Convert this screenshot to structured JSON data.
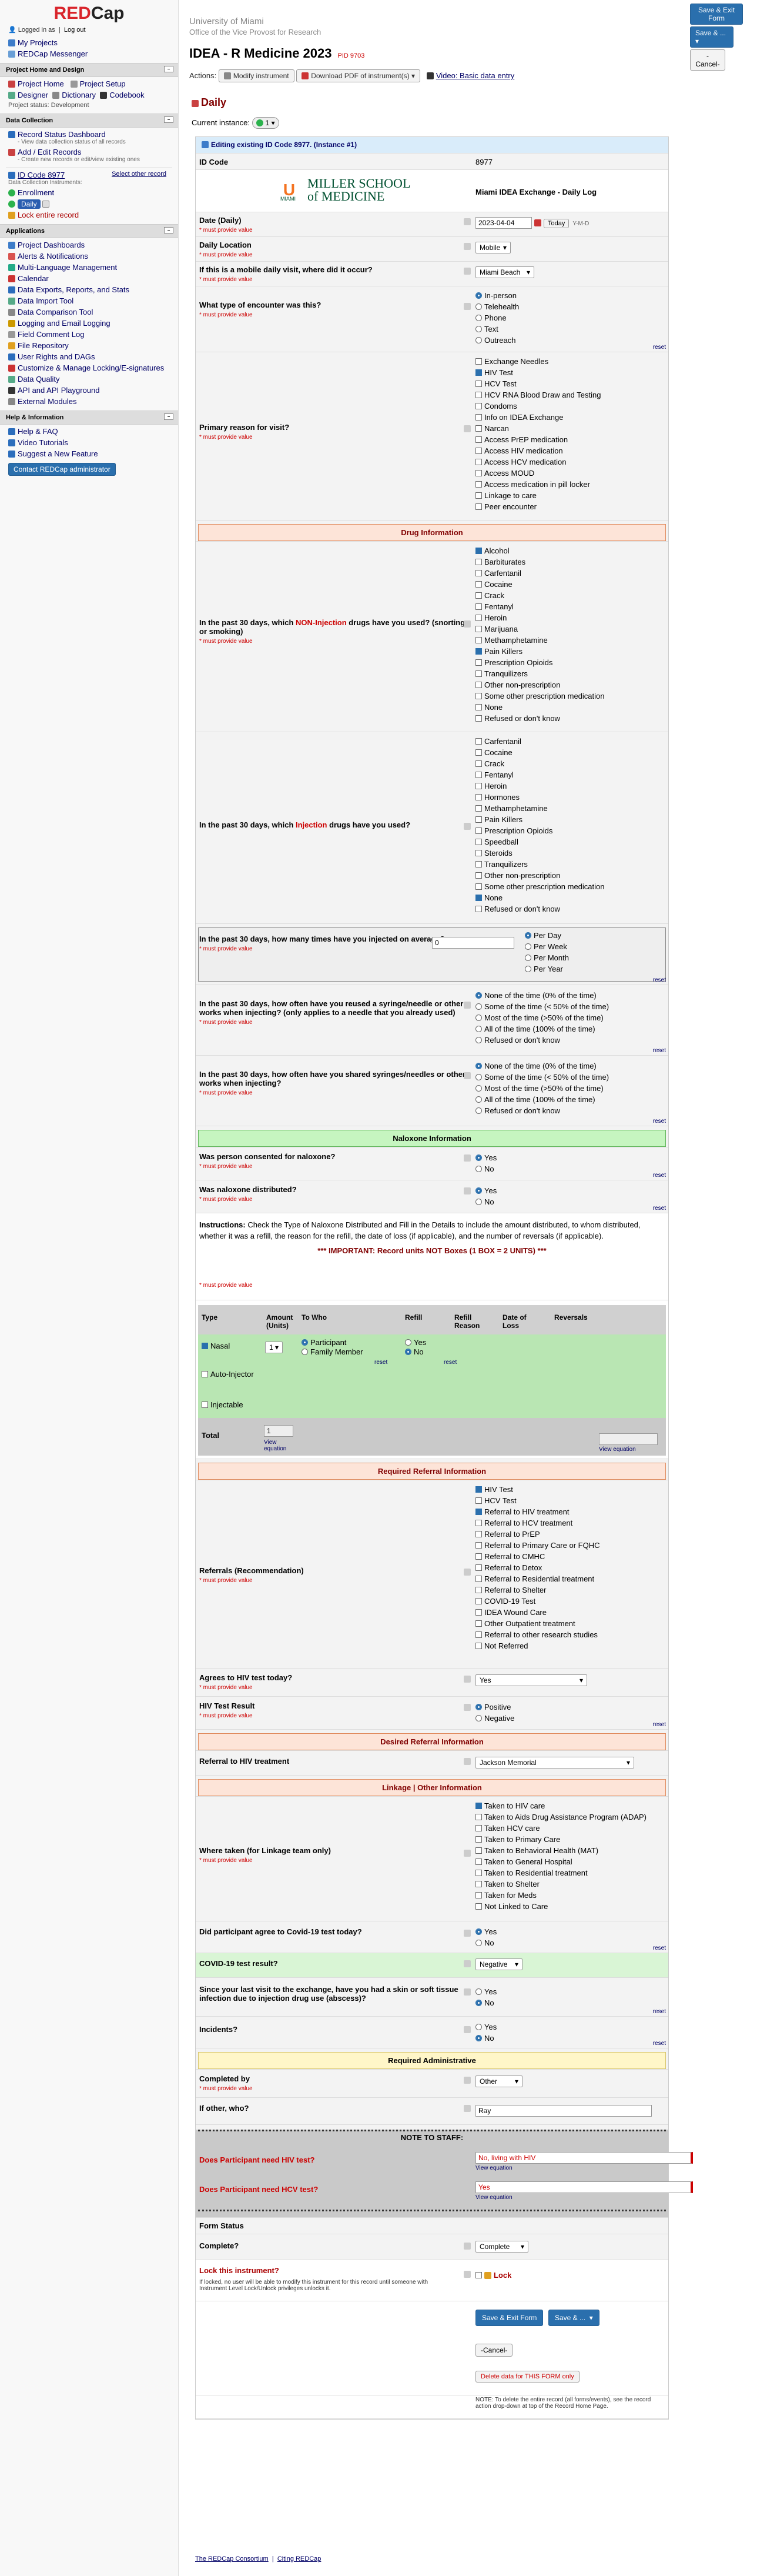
{
  "sidebar": {
    "logo": "REDCap",
    "logged_in": "Logged in as",
    "logout": "Log out",
    "my_projects": "My Projects",
    "messenger": "REDCap Messenger",
    "home_head": "Project Home and Design",
    "project_home": "Project Home",
    "project_setup": "Project Setup",
    "designer": "Designer",
    "dictionary": "Dictionary",
    "codebook": "Codebook",
    "project_status": "Project status: Development",
    "data_head": "Data Collection",
    "record_dash": "Record Status Dashboard",
    "record_dash_sub": "- View data collection status of all records",
    "add_edit": "Add / Edit Records",
    "add_edit_sub": "- Create new records or edit/view existing ones",
    "id_code": "ID Code 8977",
    "select_other": "Select other record",
    "instr_head": "Data Collection Instruments:",
    "enrollment": "Enrollment",
    "daily": "Daily",
    "lock_entire": "Lock entire record",
    "apps_head": "Applications",
    "apps": [
      "Project Dashboards",
      "Alerts & Notifications",
      "Multi-Language Management",
      "Calendar",
      "Data Exports, Reports, and Stats",
      "Data Import Tool",
      "Data Comparison Tool",
      "Logging and Email Logging",
      "Field Comment Log",
      "File Repository",
      "User Rights and DAGs",
      "Customize & Manage Locking/E-signatures",
      "Data Quality",
      "API and API Playground",
      "External Modules"
    ],
    "help_head": "Help & Information",
    "help": [
      "Help & FAQ",
      "Video Tutorials",
      "Suggest a New Feature"
    ],
    "contact": "Contact REDCap administrator"
  },
  "header": {
    "inst1": "University of Miami",
    "inst2": "Office of the Vice Provost for Research",
    "project": "IDEA - R Medicine 2023",
    "pid": "PID 9703",
    "save_exit": "Save & Exit Form",
    "save_more": "Save & ...",
    "cancel": "Cancel",
    "actions": "Actions:",
    "modify": "Modify instrument",
    "pdf": "Download PDF of instrument(s)",
    "video": "Video: Basic data entry",
    "form_title": "Daily",
    "current_instance": "Current instance:",
    "instance_val": "1"
  },
  "form": {
    "editing": "Editing existing ID Code 8977. (Instance #1)",
    "id_label": "ID Code",
    "id_value": "8977",
    "logo_text1": "MILLER SCHOOL",
    "logo_text2": "of MEDICINE",
    "logo_small": "MIAMI",
    "logo_right": "Miami IDEA Exchange - Daily Log",
    "must": "* must provide value",
    "date_label": "Date (Daily)",
    "date_value": "2023-04-04",
    "today": "Today",
    "ymd": "Y-M-D",
    "loc_label": "Daily Location",
    "loc_value": "Mobile",
    "mobile_label": "If this is a mobile daily visit, where did it occur?",
    "mobile_value": "Miami Beach",
    "enc_label": "What type of encounter was this?",
    "enc_opts": [
      "In-person",
      "Telehealth",
      "Phone",
      "Text",
      "Outreach"
    ],
    "reason_label": "Primary reason for visit?",
    "reason_opts": [
      "Exchange Needles",
      "HIV Test",
      "HCV Test",
      "HCV RNA Blood Draw and Testing",
      "Condoms",
      "Info on IDEA Exchange",
      "Narcan",
      "Access PrEP medication",
      "Access HIV medication",
      "Access HCV medication",
      "Access MOUD",
      "Access medication in pill locker",
      "Linkage to care",
      "Peer encounter"
    ],
    "drug_head": "Drug Information",
    "noninj_label_a": "In the past 30 days, which ",
    "noninj_label_b": "NON-Injection",
    "noninj_label_c": " drugs have you used? (snorting or smoking)",
    "noninj_opts": [
      "Alcohol",
      "Barbiturates",
      "Carfentanil",
      "Cocaine",
      "Crack",
      "Fentanyl",
      "Heroin",
      "Marijuana",
      "Methamphetamine",
      "Pain Killers",
      "Prescription Opioids",
      "Tranquilizers",
      "Other non-prescription",
      "Some other prescription medication",
      "None",
      "Refused or don't know"
    ],
    "inj_label_a": "In the past 30 days, which ",
    "inj_label_b": "Injection",
    "inj_label_c": " drugs have you used?",
    "inj_opts": [
      "Carfentanil",
      "Cocaine",
      "Crack",
      "Fentanyl",
      "Heroin",
      "Hormones",
      "Methamphetamine",
      "Pain Killers",
      "Prescription Opioids",
      "Speedball",
      "Steroids",
      "Tranquilizers",
      "Other non-prescription",
      "Some other prescription medication",
      "None",
      "Refused or don't know"
    ],
    "times_label": "In the past 30 days, how many times have you injected on average?",
    "times_value": "0",
    "times_opts": [
      "Per Day",
      "Per Week",
      "Per Month",
      "Per Year"
    ],
    "reuse_label": "In the past 30 days, how often have you reused a syringe/needle or other works when injecting? (only applies to a needle that you already used)",
    "share_label": "In the past 30 days, how often have you shared syringes/needles or other works when injecting?",
    "freq_opts": [
      "None of the time (0% of the time)",
      "Some of the time (< 50% of the time)",
      "Most of the time (>50% of the time)",
      "All of the time (100% of the time)",
      "Refused or don't know"
    ],
    "nalox_head": "Naloxone Information",
    "consent_label": "Was person consented for naloxone?",
    "dist_label": "Was naloxone distributed?",
    "yes": "Yes",
    "no": "No",
    "instructions_a": "Instructions:",
    "instructions_b": " Check the Type of Naloxone Distributed and Fill in the Details to include the amount distributed, to whom distributed, whether it was a refill, the reason for the refill,  the date of loss (if applicable), and the number of reversals (if applicable).",
    "important": "*** IMPORTANT: Record units NOT Boxes (1 BOX = 2 UNITS) ***",
    "tbl_heads": [
      "Type",
      "Amount (Units)",
      "To Who",
      "Refill",
      "Refill Reason",
      "Date of Loss",
      "Reversals"
    ],
    "nasal": "Nasal",
    "auto": "Auto-Injector",
    "injectable": "Injectable",
    "amount_val": "1",
    "participant": "Participant",
    "family": "Family Member",
    "total": "Total",
    "total_val": "1",
    "view_eq": "View equation",
    "reset": "reset",
    "ref_head": "Required Referral Information",
    "ref_label": "Referrals (Recommendation)",
    "ref_opts": [
      "HIV Test",
      "HCV Test",
      "Referral to HIV treatment",
      "Referral to HCV treatment",
      "Referral to PrEP",
      "Referral to Primary Care or FQHC",
      "Referral to CMHC",
      "Referral to Detox",
      "Referral to Residential treatment",
      "Referral to Shelter",
      "COVID-19 Test",
      "IDEA Wound Care",
      "Other Outpatient treatment",
      "Referral to other research studies",
      "Not Referred"
    ],
    "agree_label": "Agrees to HIV test today?",
    "agree_val": "Yes",
    "hivres_label": "HIV Test Result",
    "hivres_opts": [
      "Positive",
      "Negative"
    ],
    "desired_head": "Desired Referral Information",
    "reftx_label": "Referral to HIV treatment",
    "reftx_val": "Jackson Memorial",
    "link_head": "Linkage | Other Information",
    "where_label": "Where taken (for Linkage team only)",
    "where_opts": [
      "Taken to HIV care",
      "Taken to Aids Drug Assistance Program (ADAP)",
      "Taken HCV care",
      "Taken to Primary Care",
      "Taken to Behavioral Health (MAT)",
      "Taken to General Hospital",
      "Taken to Residential treatment",
      "Taken to Shelter",
      "Taken for Meds",
      "Not Linked to Care"
    ],
    "covid_agree_label": "Did participant agree to Covid-19 test today?",
    "covid_res_label": "COVID-19 test result?",
    "covid_res_val": "Negative",
    "abscess_label": "Since your last visit to the exchange, have you had a skin or soft tissue infection due to injection drug use (abscess)?",
    "incid_label": "Incidents?",
    "admin_head": "Required Administrative",
    "completed_label": "Completed by",
    "completed_val": "Other",
    "ifother_label": "If other, who?",
    "ifother_val": "Ray",
    "note_head": "NOTE TO STAFF:",
    "hivneed_label": "Does Participant need HIV test?",
    "hivneed_val": "No, living with HIV",
    "hcvneed_label": "Does Participant need HCV test?",
    "hcvneed_val": "Yes",
    "status_head": "Form Status",
    "complete_label": "Complete?",
    "complete_val": "Complete",
    "lock_label": "Lock this instrument?",
    "lock_note": "If locked, no user will be able to modify this instrument for this record until someone with Instrument Level Lock/Unlock privileges unlocks it.",
    "lock": "Lock",
    "delete": "Delete data for THIS FORM only",
    "delete_note": "NOTE: To delete the entire record (all forms/events), see the record action drop-down at top of the Record Home Page."
  },
  "footer": {
    "consortium": "The REDCap Consortium",
    "citing": "Citing REDCap"
  }
}
